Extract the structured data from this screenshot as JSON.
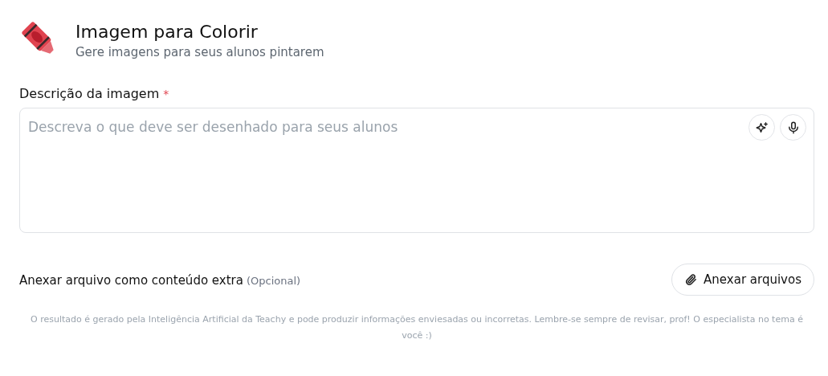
{
  "header": {
    "title": "Imagem para Colorir",
    "subtitle": "Gere imagens para seus alunos pintarem"
  },
  "description_field": {
    "label": "Descrição da imagem",
    "required_mark": "*",
    "placeholder": "Descreva o que deve ser desenhado para seus alunos"
  },
  "attachment": {
    "label": "Anexar arquivo como conteúdo extra",
    "optional_note": "(Opcional)",
    "button": "Anexar arquivos"
  },
  "disclaimer": "O resultado é gerado pela Inteligência Artificial da Teachy e pode produzir informações enviesadas ou incorretas. Lembre-se sempre de revisar, prof! O especialista no tema é você :)"
}
